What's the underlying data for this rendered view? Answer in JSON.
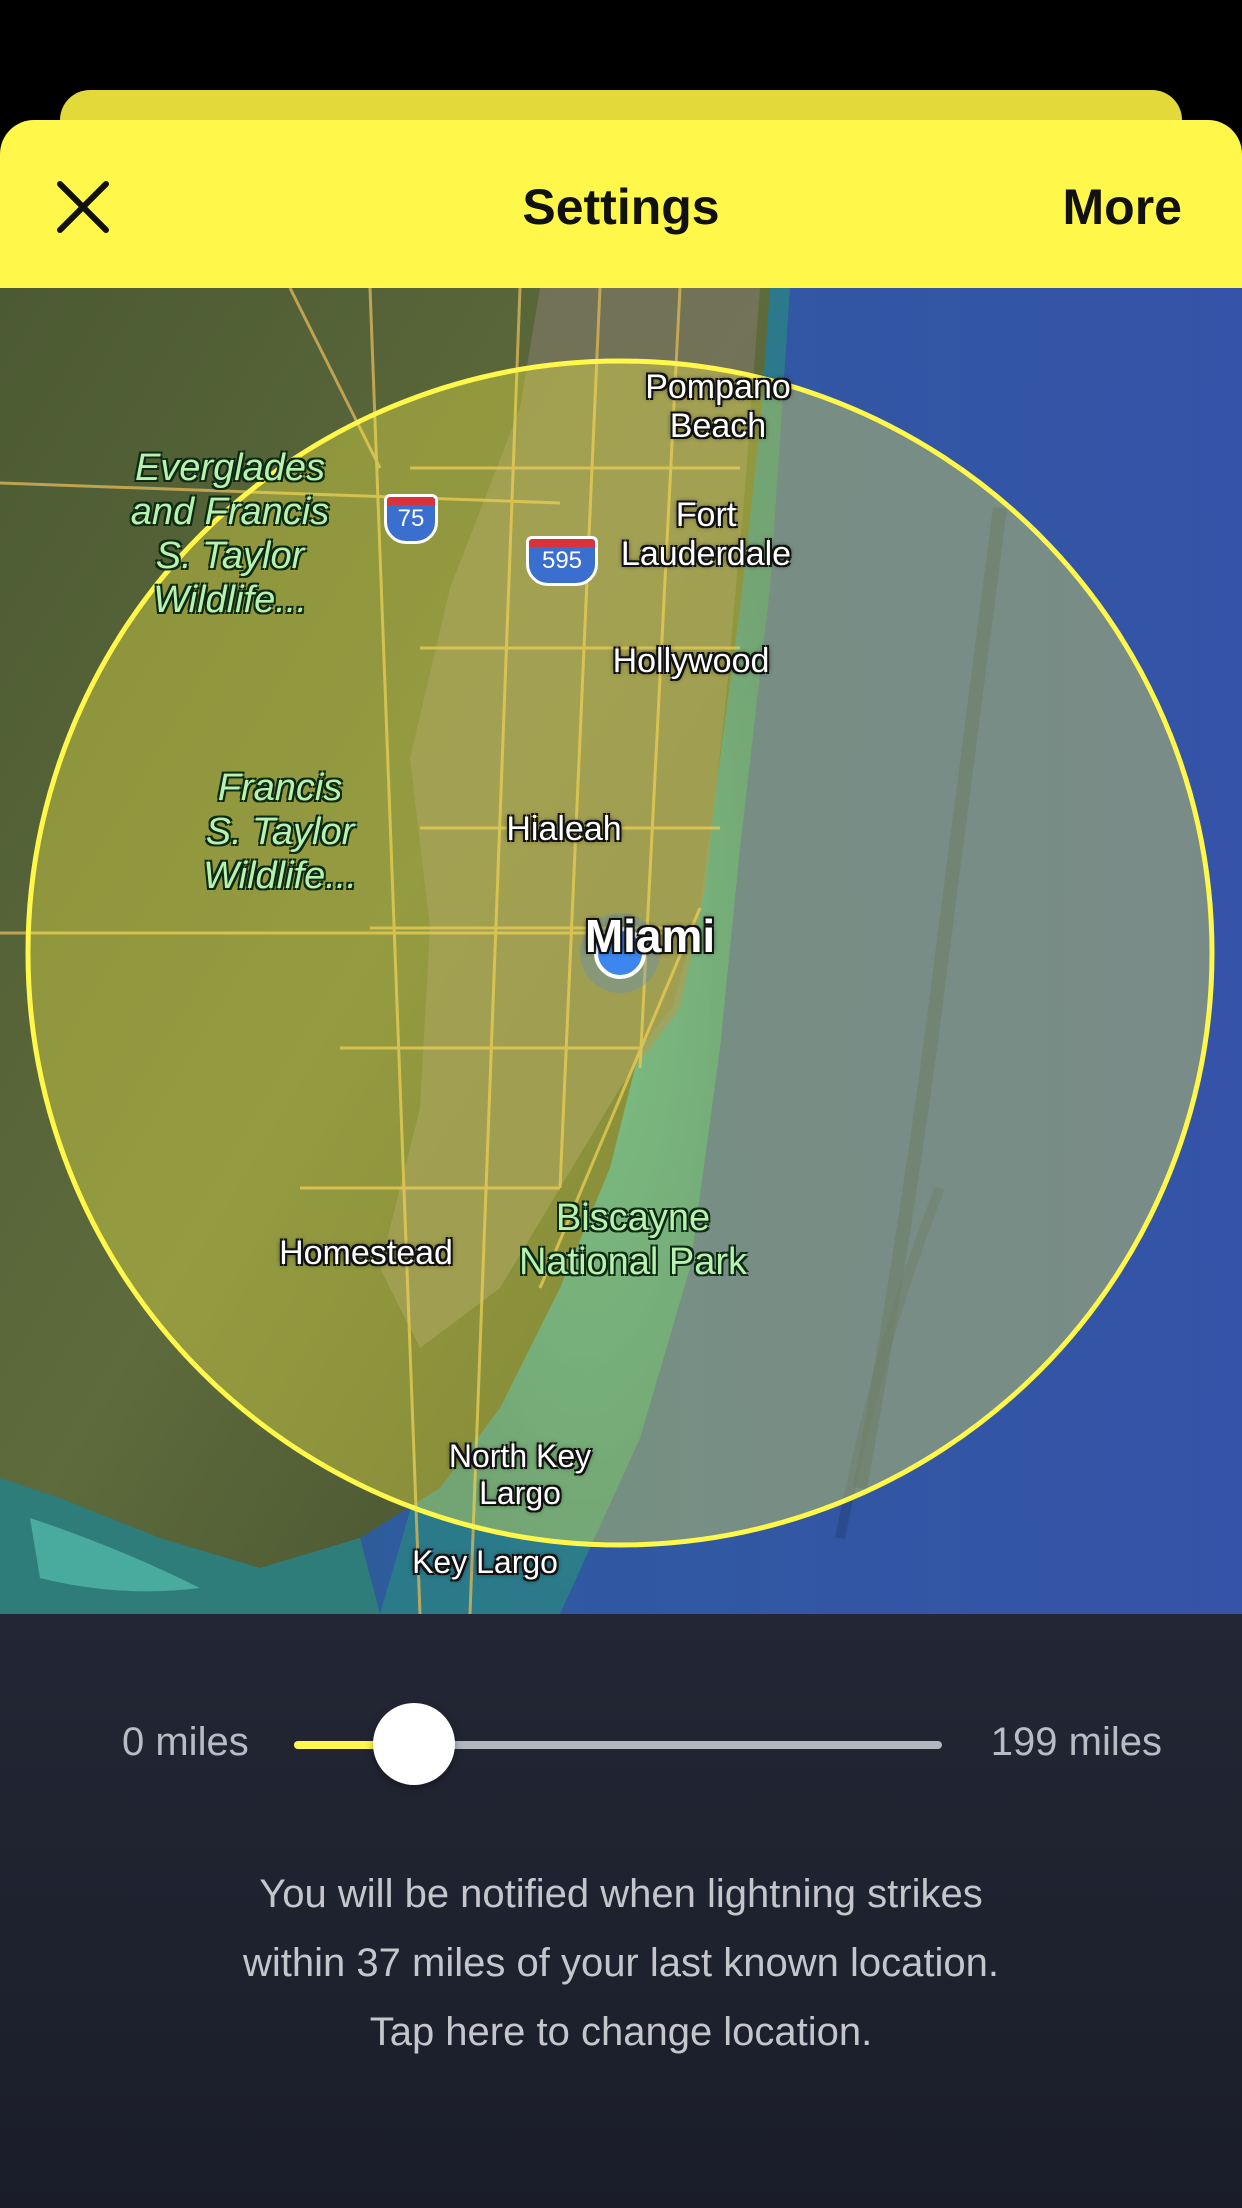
{
  "header": {
    "title": "Settings",
    "more_label": "More",
    "accent_color": "#fff84a"
  },
  "map": {
    "cities": {
      "pompano": "Pompano\nBeach",
      "fort_lauderdale": "Fort\nLauderdale",
      "hollywood": "Hollywood",
      "hialeah": "Hialeah",
      "miami": "Miami",
      "homestead": "Homestead",
      "north_key_largo": "North Key\nLargo",
      "key_largo": "Key Largo"
    },
    "parks": {
      "everglades": "Everglades\nand Francis\nS. Taylor\nWildlife...",
      "francis": "Francis\nS. Taylor\nWildlife...",
      "biscayne": "Biscayne\nNational Park"
    },
    "highways": {
      "i75": "75",
      "i595": "595"
    },
    "radius_color": "#fff84a",
    "location_dot_color": "#3d86f0"
  },
  "slider": {
    "min_label": "0 miles",
    "max_label": "199 miles",
    "min_value": 0,
    "max_value": 199,
    "value": 37
  },
  "notification": {
    "line1": "You will be notified when lightning strikes",
    "line2": "within 37 miles of your last known location.",
    "line3": "Tap here to change location."
  }
}
